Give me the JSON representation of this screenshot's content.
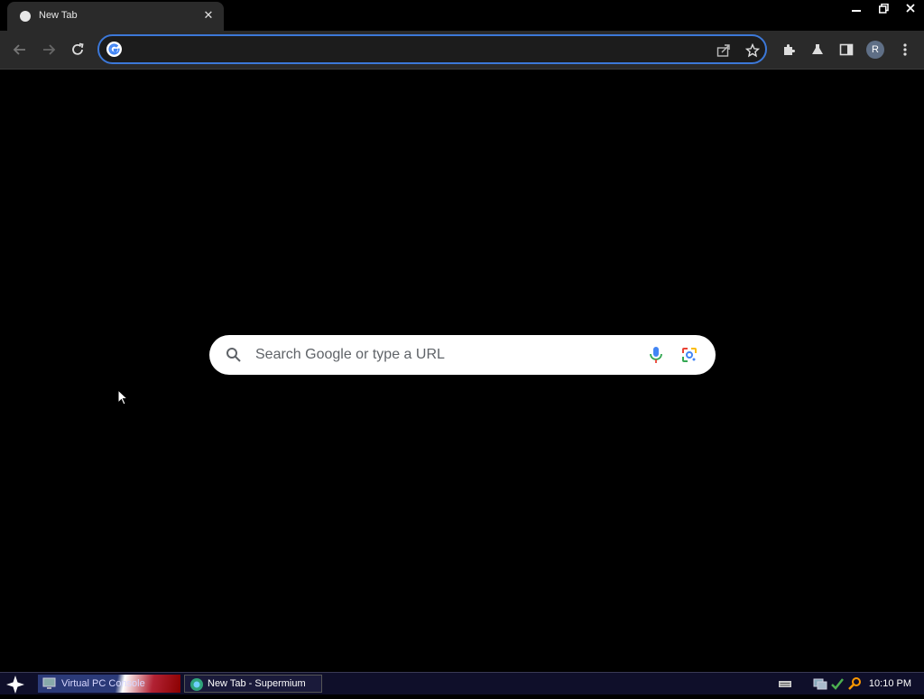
{
  "browser": {
    "tab": {
      "title": "New Tab",
      "close_icon": "close-icon",
      "favicon": "globe-icon"
    },
    "window_controls": {
      "minimize_icon": "minimize-icon",
      "restore_icon": "restore-icon",
      "close_icon": "close-icon"
    },
    "toolbar": {
      "back_icon": "back-arrow-icon",
      "forward_icon": "forward-arrow-icon",
      "reload_icon": "reload-icon",
      "omnibox": {
        "value": "",
        "placeholder": "",
        "google_icon": "google-g-icon",
        "share_icon": "share-icon",
        "bookmark_icon": "star-icon"
      },
      "extensions_icon": "puzzle-icon",
      "labs_icon": "flask-icon",
      "side_panel_icon": "side-panel-icon",
      "avatar_initial": "R",
      "menu_icon": "kebab-menu-icon"
    }
  },
  "ntp": {
    "search_placeholder": "Search Google or type a URL",
    "search_icon": "magnifier-icon",
    "voice_icon": "microphone-icon",
    "lens_icon": "camera-lens-icon"
  },
  "taskbar": {
    "start_icon": "star-start-icon",
    "items": [
      {
        "label": "Virtual PC Console",
        "icon": "monitor-icon"
      },
      {
        "label": "New Tab - Supermium",
        "icon": "browser-icon"
      }
    ],
    "tray": {
      "keyboard_icon": "keyboard-icon",
      "network_icon": "network-icon",
      "check_icon": "check-icon",
      "search_icon": "magnifier-icon"
    },
    "clock": "10:10 PM"
  },
  "colors": {
    "accent": "#3c78d8",
    "toolbar": "#2a2a2a",
    "background": "#000000",
    "taskbar": "#0f0f2a"
  }
}
